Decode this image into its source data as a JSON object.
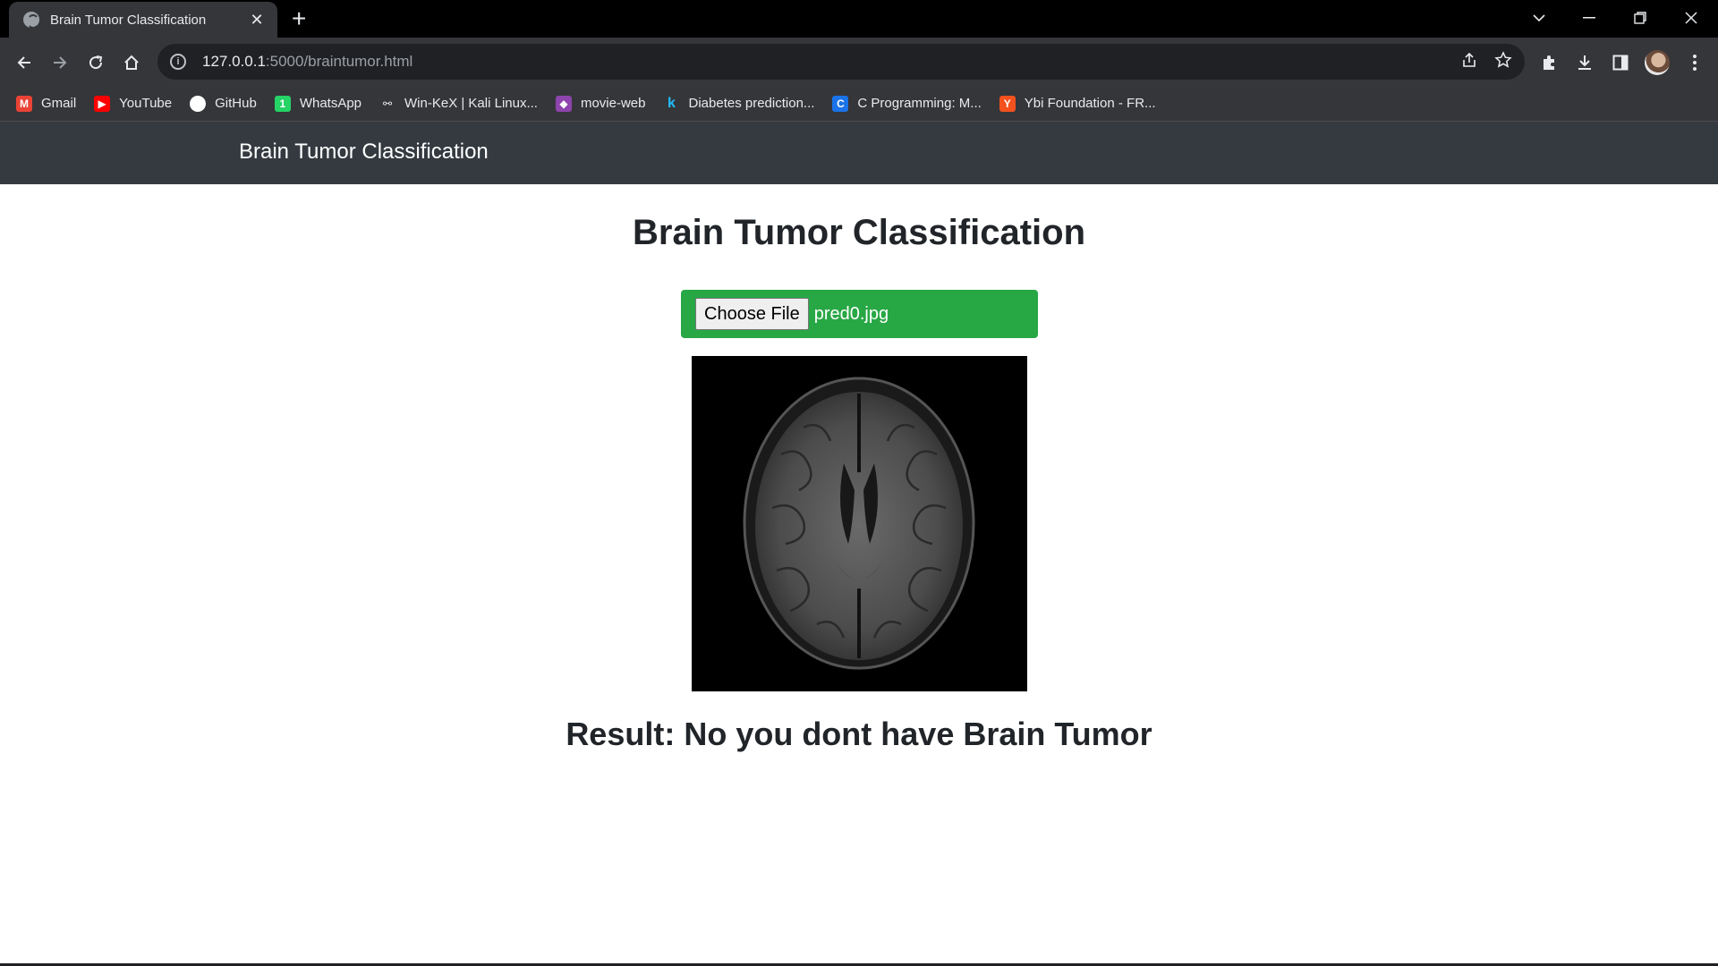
{
  "browser": {
    "tab_title": "Brain Tumor Classification",
    "tab_close": "✕",
    "new_tab": "+",
    "url_host": "127.0.0.1",
    "url_path": ":5000/braintumor.html",
    "bookmarks": [
      {
        "label": "Gmail",
        "icon": "gmail-icon",
        "color": "#ea4335",
        "glyph": "M"
      },
      {
        "label": "YouTube",
        "icon": "youtube-icon",
        "color": "#ff0000",
        "glyph": "▶"
      },
      {
        "label": "GitHub",
        "icon": "github-icon",
        "color": "#ffffff",
        "glyph": ""
      },
      {
        "label": "WhatsApp",
        "icon": "whatsapp-icon",
        "color": "#25d366",
        "glyph": "1"
      },
      {
        "label": "Win-KeX | Kali Linux...",
        "icon": "kali-icon",
        "color": "#35363a",
        "glyph": "⚯"
      },
      {
        "label": "movie-web",
        "icon": "movie-web-icon",
        "color": "#8e44ad",
        "glyph": "◆"
      },
      {
        "label": "Diabetes prediction...",
        "icon": "kaggle-icon",
        "color": "#35363a",
        "glyph": "k"
      },
      {
        "label": "C Programming: M...",
        "icon": "c-programming-icon",
        "color": "#1a73e8",
        "glyph": "C"
      },
      {
        "label": "Ybi Foundation - FR...",
        "icon": "ybi-icon",
        "color": "#f4511e",
        "glyph": "Y"
      }
    ]
  },
  "navbar": {
    "brand": "Brain Tumor Classification"
  },
  "main": {
    "heading": "Brain Tumor Classification",
    "choose_file_label": "Choose File",
    "file_name": "pred0.jpg",
    "result_text": "Result: No you dont have Brain Tumor"
  },
  "colors": {
    "navbar_bg": "#343a40",
    "upload_bg": "#28a745",
    "text_dark": "#212529"
  }
}
